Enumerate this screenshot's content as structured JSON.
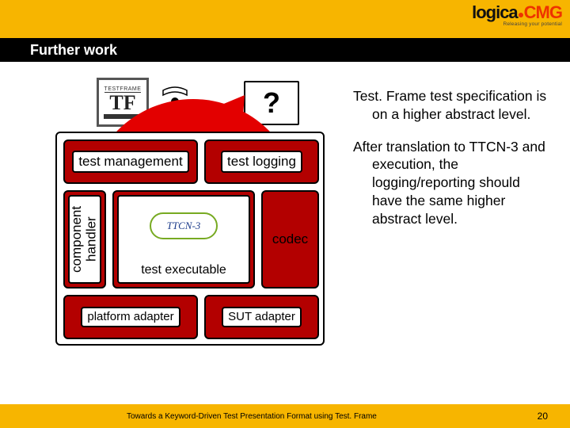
{
  "header": {
    "logo_main": "logica",
    "logo_cmg": "CMG",
    "logo_tagline": "Releasing your potential",
    "title": "Further work"
  },
  "side": {
    "p1": "Test. Frame test specification is on a higher abstract level.",
    "p2": "After translation to TTCN-3 and execution, the logging/reporting should have the same higher abstract level."
  },
  "diagram": {
    "tf_logo_top": "TESTFRAME",
    "tf_logo_tf": "TF",
    "question": "?",
    "test_management": "test management",
    "test_logging": "test logging",
    "component_handler": "component handler",
    "ttcn_label": "TTCN-3",
    "test_executable": "test executable",
    "codec": "codec",
    "platform_adapter": "platform adapter",
    "sut_adapter": "SUT adapter"
  },
  "footer": {
    "caption": "Towards a Keyword-Driven Test Presentation Format using Test. Frame",
    "page": "20"
  }
}
